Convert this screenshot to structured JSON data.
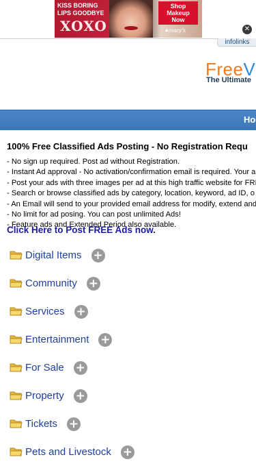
{
  "ad": {
    "headline": "KISS BORING\nLIPS GOODBYE",
    "product": "XOXO",
    "cta": "Shop\nMakeup\nNow",
    "brand": "★macy's",
    "close_icon": "close-icon",
    "provider": "infolinks"
  },
  "logo": {
    "main_a": "Free",
    "main_b": "V",
    "tagline": "The Ultimate"
  },
  "nav": {
    "home_label": "Hom"
  },
  "content": {
    "heading": "100% Free Classified Ads Posting - No Registration Requ",
    "bullets": [
      "- No sign up required. Post ad without Registration.",
      "- Instant Ad approval - No activation/confirmation email is required. Your a",
      "- Post your ads with three images per ad at this high traffic website for FRI",
      "- Search or browse classified ads by category, location, keyword, ad ID, o",
      "- An Email will send to your provided email address for modify, extend and",
      "- No limit for ad posing. You can post unlimited Ads!",
      "- Feature ads and Extended Period also available."
    ],
    "cta_link": "Click Here to Post FREE Ads now."
  },
  "categories": [
    {
      "label": "Digital Items"
    },
    {
      "label": "Community"
    },
    {
      "label": "Services"
    },
    {
      "label": "Entertainment"
    },
    {
      "label": "For Sale"
    },
    {
      "label": "Property"
    },
    {
      "label": "Tickets"
    },
    {
      "label": "Pets and Livestock"
    }
  ],
  "colors": {
    "nav": "#3d76b5",
    "link": "#1a1aa6",
    "category": "#1f3f9a",
    "logo_orange": "#f07b1f",
    "logo_blue": "#2a8ad6"
  }
}
